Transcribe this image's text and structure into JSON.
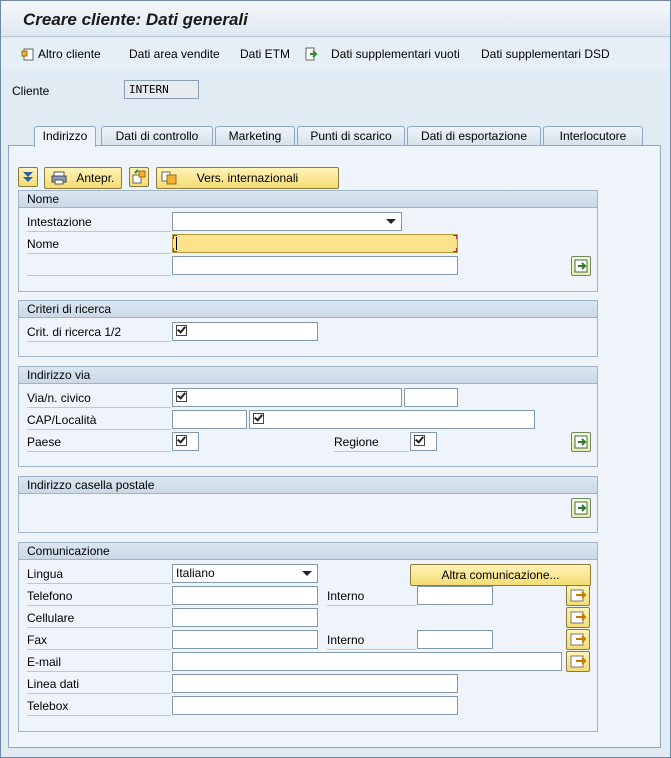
{
  "window": {
    "title": "Creare cliente: Dati generali"
  },
  "toolbar": {
    "items": [
      {
        "label": "Altro cliente",
        "icon": "new-document-icon"
      },
      {
        "label": "Dati area vendite"
      },
      {
        "label": "Dati ETM"
      },
      {
        "label": "",
        "icon": "export-document-icon"
      },
      {
        "label": "Dati supplementari vuoti"
      },
      {
        "label": "Dati supplementari DSD"
      }
    ]
  },
  "client": {
    "label": "Cliente",
    "value": "INTERN"
  },
  "tabs": [
    {
      "label": "Indirizzo",
      "active": true
    },
    {
      "label": "Dati di controllo"
    },
    {
      "label": "Marketing"
    },
    {
      "label": "Punti di scarico"
    },
    {
      "label": "Dati di esportazione"
    },
    {
      "label": "Interlocutore"
    }
  ],
  "actions": {
    "preview_label": "Antepr.",
    "intl_versions_label": "Vers. internazionali"
  },
  "sections": {
    "nome": {
      "title": "Nome",
      "title_label": "Intestazione",
      "title_value": "",
      "name_label": "Nome",
      "name_value": "",
      "name2_value": ""
    },
    "ricerca": {
      "title": "Criteri di ricerca",
      "search_label": "Crit. di ricerca 1/2"
    },
    "indirizzo_via": {
      "title": "Indirizzo via",
      "street_label": "Via/n. civico",
      "postal_label": "CAP/Località",
      "country_label": "Paese",
      "region_label": "Regione"
    },
    "casella": {
      "title": "Indirizzo casella postale"
    },
    "comunicazione": {
      "title": "Comunicazione",
      "language_label": "Lingua",
      "language_value": "Italiano",
      "other_comm_label": "Altra comunicazione...",
      "phone_label": "Telefono",
      "phone_ext_label": "Interno",
      "mobile_label": "Cellulare",
      "fax_label": "Fax",
      "fax_ext_label": "Interno",
      "email_label": "E-mail",
      "dataline_label": "Linea dati",
      "telebox_label": "Telebox"
    }
  },
  "colors": {
    "background": "#e1ebf4",
    "button": "#f4dc74",
    "required_field": "#fbe28c"
  }
}
